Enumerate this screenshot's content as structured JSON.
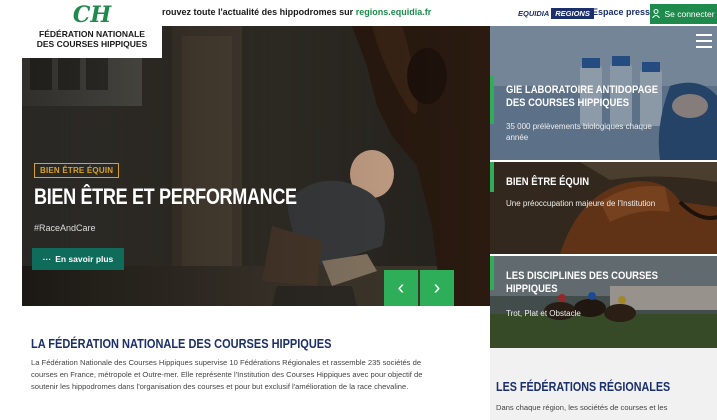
{
  "header": {
    "logo_mark": "CH",
    "logo_line1": "FÉDÉRATION NATIONALE",
    "logo_line2": "DES COURSES HIPPIQUES",
    "announce_text": "rouvez toute l'actualité des hippodromes sur ",
    "announce_link": "regions.equidia.fr",
    "equidia_label": "EQUIDIA",
    "regions_label": "REGIONS",
    "espace_presse": "Espace presse",
    "connect_label": "Se connecter"
  },
  "hero": {
    "badge": "BIEN ÊTRE ÉQUIN",
    "title": "BIEN ÊTRE ET PERFORMANCE",
    "hashtag": "#RaceAndCare",
    "button_label": "En savoir plus",
    "prev_arrow": "‹",
    "next_arrow": "›"
  },
  "cards": [
    {
      "title": "GIE LABORATOIRE ANTIDOPAGE DES COURSES HIPPIQUES",
      "subtitle": "35 000 prélèvements biologiques chaque année"
    },
    {
      "title": "BIEN ÊTRE ÉQUIN",
      "subtitle": "Une préoccupation majeure de l'Institution"
    },
    {
      "title": "LES DISCIPLINES DES COURSES HIPPIQUES",
      "subtitle": "Trot, Plat et Obstacle"
    }
  ],
  "main": {
    "title": "LA FÉDÉRATION NATIONALE DES COURSES HIPPIQUES",
    "text": "La Fédération Nationale des Courses Hippiques supervise 10 Fédérations Régionales et rassemble 235 sociétés de courses en France, métropole et Outre-mer. Elle représente l'Institution des Courses Hippiques avec pour objectif de soutenir les hippodromes dans l'organisation des courses et pour but exclusif l'amélioration de la race chevaline."
  },
  "regions": {
    "title": "LES FÉDÉRATIONS RÉGIONALES",
    "text": "Dans chaque région, les sociétés de courses et les"
  },
  "colors": {
    "brand_green": "#2fae5a",
    "navy": "#1a2f6b",
    "dark_teal": "#0f6b5a",
    "gold": "#d9a22a"
  }
}
